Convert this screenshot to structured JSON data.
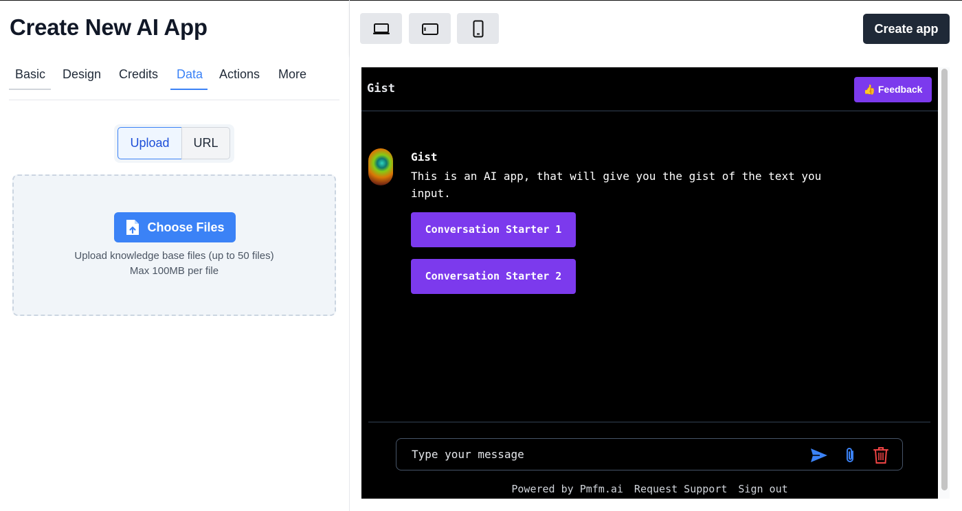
{
  "left": {
    "title": "Create New AI App",
    "tabs": [
      {
        "label": "Basic"
      },
      {
        "label": "Design"
      },
      {
        "label": "Credits"
      },
      {
        "label": "Data"
      },
      {
        "label": "Actions"
      },
      {
        "label": "More"
      }
    ],
    "active_tab": "Data",
    "source_toggle": {
      "upload": "Upload",
      "url": "URL",
      "selected": "Upload"
    },
    "dropzone": {
      "button": "Choose Files",
      "hint_line1": "Upload knowledge base files (up to 50 files)",
      "hint_line2": "Max 100MB per file"
    }
  },
  "toolbar": {
    "devices": [
      {
        "icon": "laptop-icon"
      },
      {
        "icon": "tablet-icon"
      },
      {
        "icon": "phone-icon"
      }
    ],
    "create_label": "Create app"
  },
  "preview": {
    "app_name": "Gist",
    "feedback_label": "👍 Feedback",
    "bot_name": "Gist",
    "bot_message": "This is an AI app, that will give you the gist of the text you input.",
    "starters": [
      "Conversation Starter 1",
      "Conversation Starter 2"
    ],
    "input_placeholder": "Type your message",
    "footer": {
      "powered": "Powered by Pmfm.ai",
      "support": "Request Support",
      "signout": "Sign out"
    }
  },
  "colors": {
    "accent_blue": "#3b82f6",
    "accent_purple": "#7c3aed",
    "dark_button": "#1f2937",
    "delete_red": "#ef4444"
  }
}
